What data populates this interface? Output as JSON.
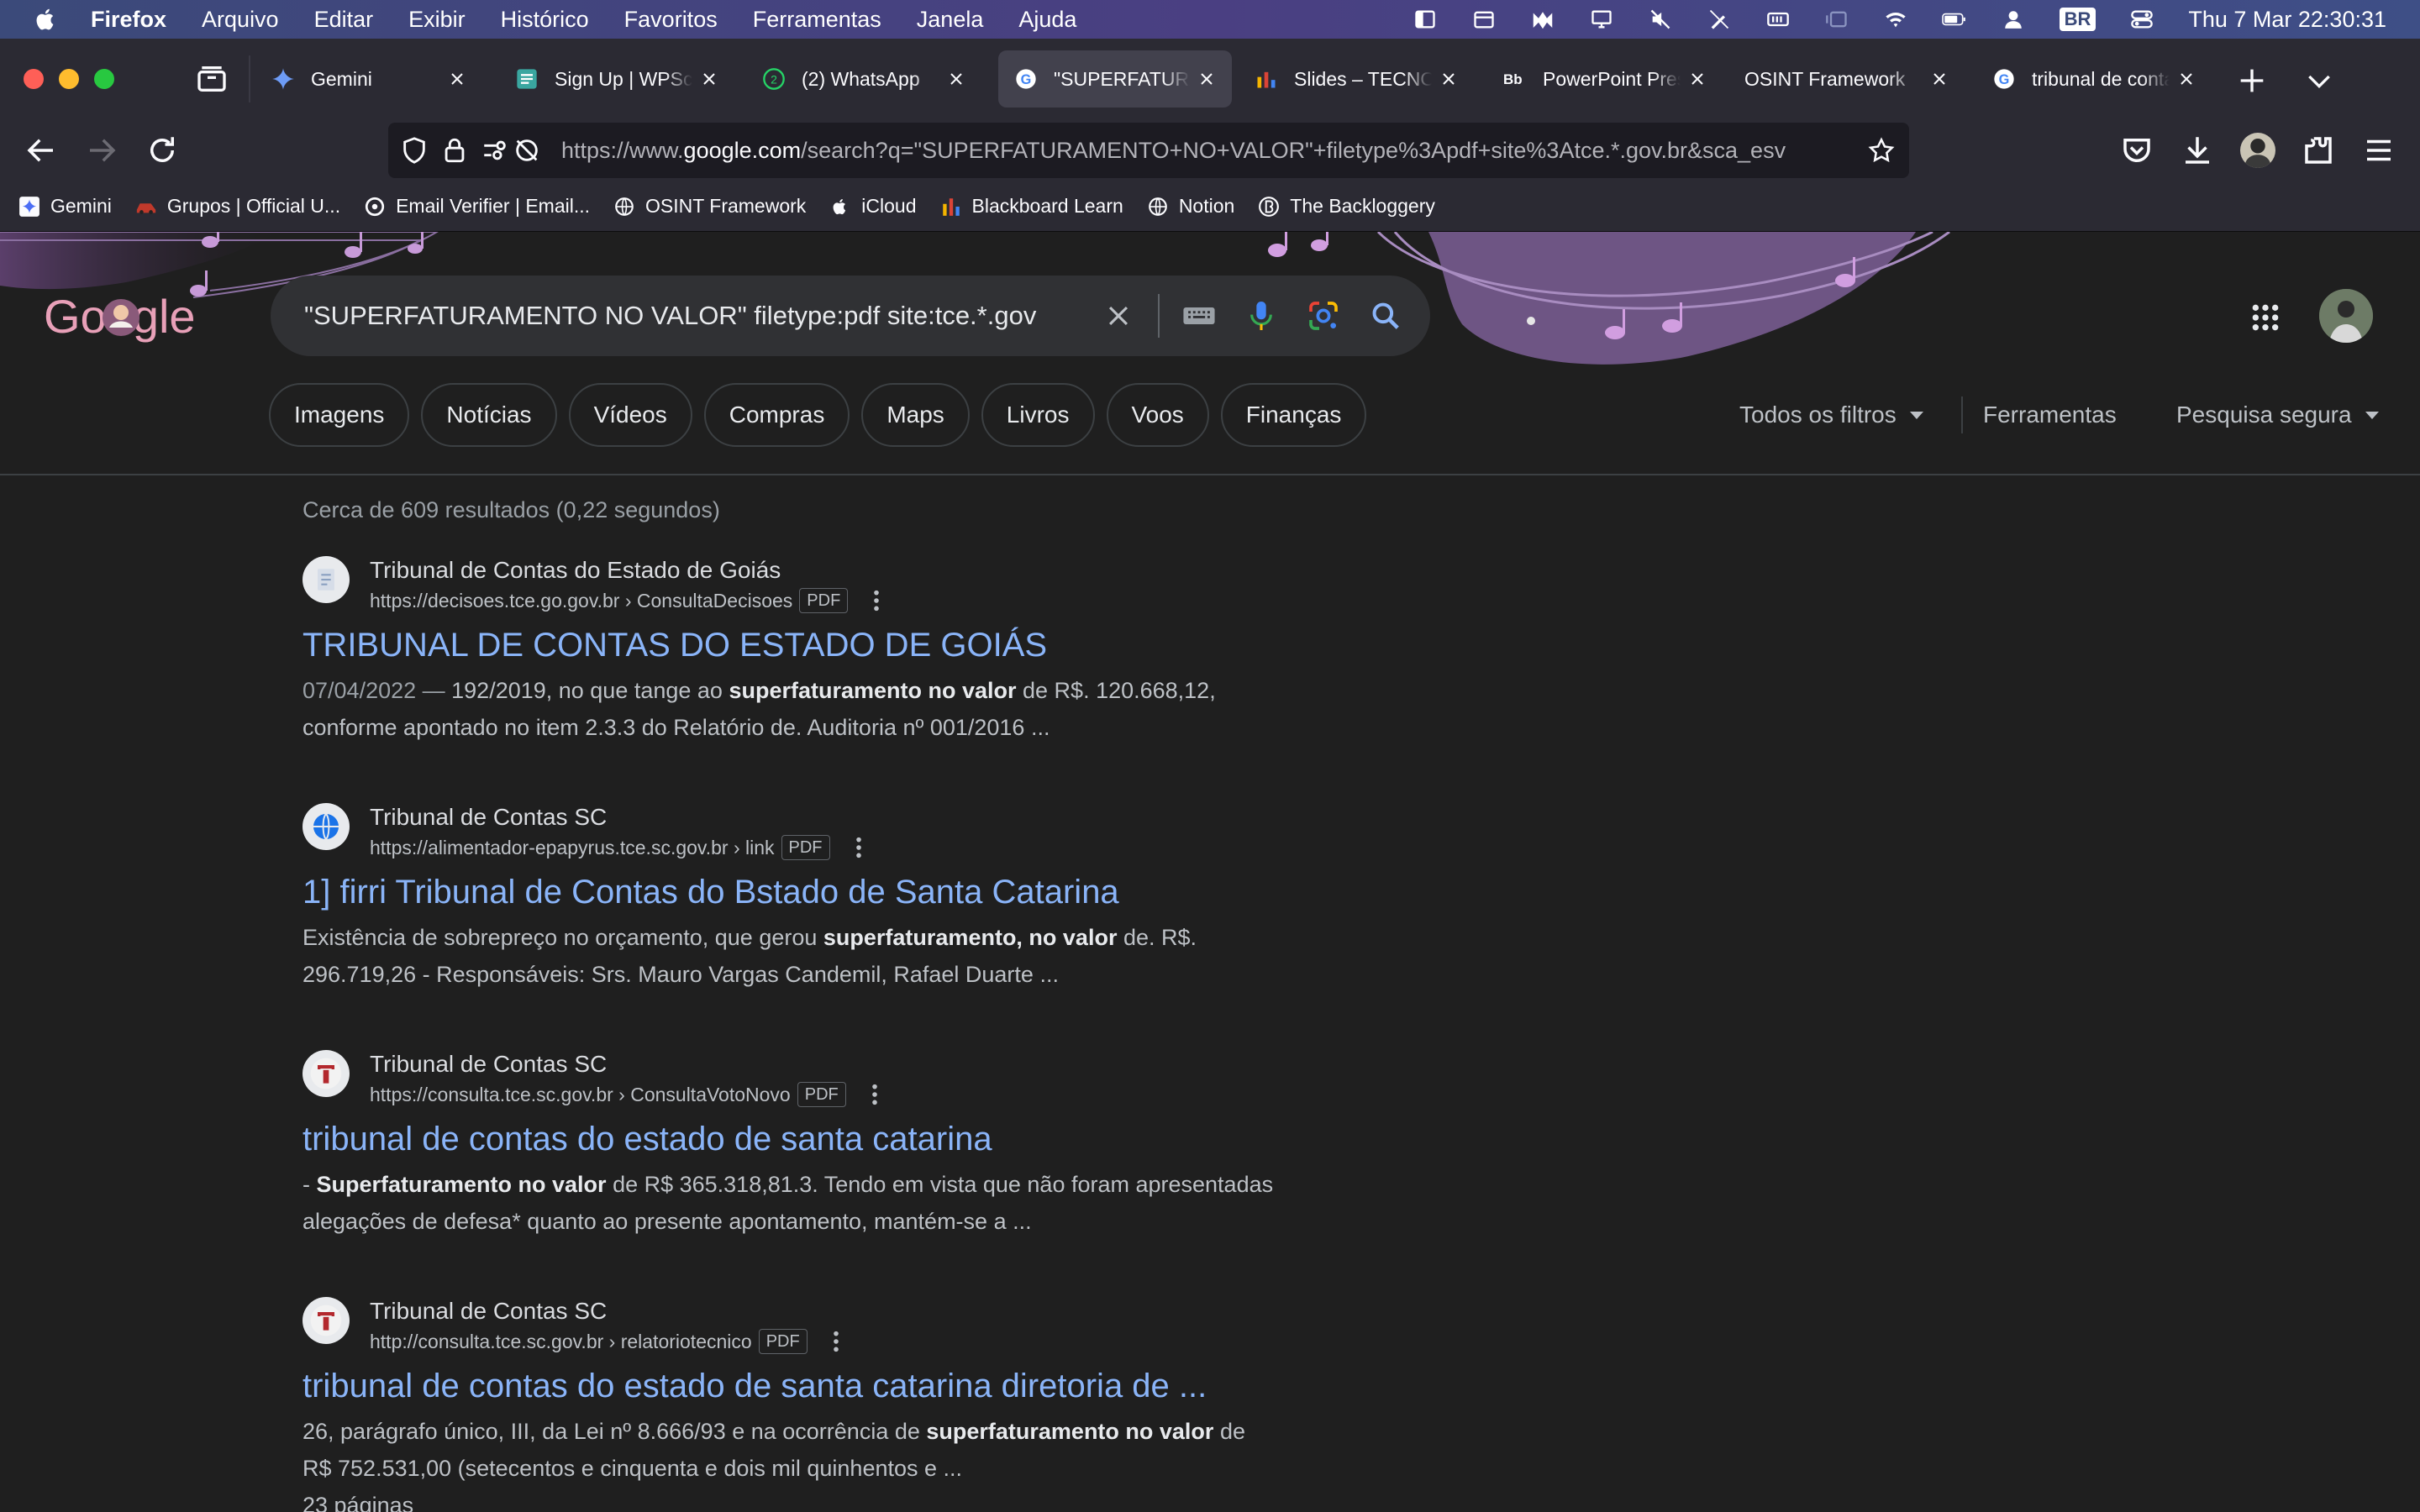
{
  "menubar": {
    "app": "Firefox",
    "items": [
      "Arquivo",
      "Editar",
      "Exibir",
      "Histórico",
      "Favoritos",
      "Ferramentas",
      "Janela",
      "Ajuda"
    ],
    "input_source": "BR",
    "clock": "Thu 7 Mar  22:30:31"
  },
  "tabs": [
    {
      "title": "Gemini",
      "icon": "gemini-icon"
    },
    {
      "title": "Sign Up | WPScan",
      "icon": "wpscan-icon"
    },
    {
      "title": "(2) WhatsApp",
      "icon": "whatsapp-icon"
    },
    {
      "title": "\"SUPERFATURAMENTO",
      "icon": "google-icon"
    },
    {
      "title": "Slides – TECNOL",
      "icon": "slides-icon"
    },
    {
      "title": "PowerPoint Prese",
      "icon": "blackboard-icon"
    },
    {
      "title": "OSINT Framework",
      "icon": "none"
    },
    {
      "title": "tribunal de conta",
      "icon": "google-icon"
    }
  ],
  "urlbar": {
    "prefix": "https://www.",
    "domain": "google.com",
    "rest": "/search?q=\"SUPERFATURAMENTO+NO+VALOR\"+filetype%3Apdf+site%3Atce.*.gov.br&sca_esv"
  },
  "bookmarks": [
    "Gemini",
    "Grupos | Official U...",
    "Email Verifier | Email...",
    "OSINT Framework",
    "iCloud",
    "Blackboard Learn",
    "Notion",
    "The Backloggery"
  ],
  "search": {
    "query": "\"SUPERFATURAMENTO NO VALOR\" filetype:pdf site:tce.*.gov",
    "logo": "Google"
  },
  "chips": [
    "Imagens",
    "Notícias",
    "Vídeos",
    "Compras",
    "Maps",
    "Livros",
    "Voos",
    "Finanças"
  ],
  "tools": {
    "filters": "Todos os filtros",
    "tools": "Ferramentas",
    "safe": "Pesquisa segura"
  },
  "stats": "Cerca de 609 resultados (0,22 segundos)",
  "results": [
    {
      "site": "Tribunal de Contas do Estado de Goiás",
      "cite": "https://decisoes.tce.go.gov.br › ConsultaDecisoes",
      "badge": "PDF",
      "title": "TRIBUNAL DE CONTAS DO ESTADO DE GOIÁS",
      "date": "07/04/2022 —",
      "s1": " 192/2019, no que tange ao ",
      "b1": "superfaturamento no valor",
      "s2": " de R$. 120.668,12,",
      "line2": "conforme apontado no item 2.3.3 do Relatório de. Auditoria nº 001/2016 ..."
    },
    {
      "site": "Tribunal de Contas SC",
      "cite": "https://alimentador-epapyrus.tce.sc.gov.br › link",
      "badge": "PDF",
      "title": "1] firri Tribunal de Contas do Bstado de Santa Catarina",
      "s1": "Existência de sobrepreço no orçamento, que gerou ",
      "b1": "superfaturamento, no valor",
      "s2": " de. R$.",
      "line2": "296.719,26 - Responsáveis: Srs. Mauro Vargas Candemil, Rafael Duarte ..."
    },
    {
      "site": "Tribunal de Contas SC",
      "cite": "https://consulta.tce.sc.gov.br › ConsultaVotoNovo",
      "badge": "PDF",
      "title": "tribunal de contas do estado de santa catarina",
      "s1": "- ",
      "b1": "Superfaturamento no valor",
      "s2": " de R$ 365.318,81.3. Tendo em vista que não foram apresentadas",
      "line2": "alegações de defesa* quanto ao presente apontamento, mantém-se a ..."
    },
    {
      "site": "Tribunal de Contas SC",
      "cite": "http://consulta.tce.sc.gov.br › relatoriotecnico",
      "badge": "PDF",
      "title": "tribunal de contas do estado de santa catarina diretoria de ...",
      "s1": "26, parágrafo único, III, da Lei nº 8.666/93 e na ocorrência de ",
      "b1": "superfaturamento no valor",
      "s2": " de",
      "line2": "R$ 752.531,00 (setecentos e cinquenta e dois mil quinhentos e ...",
      "line3": "23 páginas"
    }
  ]
}
